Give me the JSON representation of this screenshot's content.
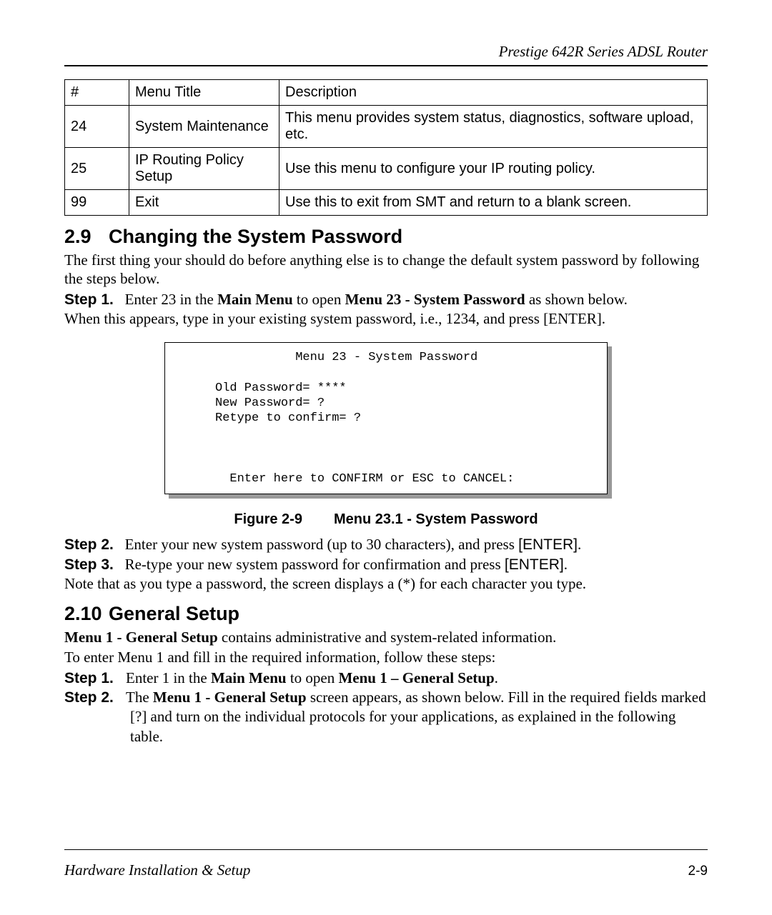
{
  "header": {
    "title": "Prestige 642R Series ADSL Router"
  },
  "table": {
    "headers": {
      "num": "#",
      "title": "Menu Title",
      "desc": "Description"
    },
    "rows": [
      {
        "num": "24",
        "title": "System Maintenance",
        "desc": "This menu provides system status, diagnostics, software upload, etc."
      },
      {
        "num": "25",
        "title": "IP Routing Policy Setup",
        "desc": "Use this menu to configure your IP routing policy."
      },
      {
        "num": "99",
        "title": "Exit",
        "desc": "Use this to exit from SMT and return to a blank screen."
      }
    ]
  },
  "section29": {
    "num": "2.9",
    "title": "Changing the System Password",
    "intro": "The first thing your should do before anything else is to change the default system password by following the steps below.",
    "step1": {
      "label": "Step 1.",
      "pre": "Enter 23 in the ",
      "bold1": "Main Menu",
      "mid": " to open ",
      "bold2": "Menu 23 - System Password",
      "post": " as shown below."
    },
    "after_step1": "When this appears, type in your existing system password, i.e., 1234, and press [ENTER].",
    "figure": {
      "title_line": "           Menu 23 - System Password",
      "body": "Old Password= ****\nNew Password= ?\nRetype to confirm= ?",
      "footer_line": "  Enter here to CONFIRM or ESC to CANCEL:"
    },
    "figure_caption": {
      "label": "Figure 2-9",
      "title": "Menu 23.1 - System Password"
    },
    "step2": {
      "label": "Step 2.",
      "text": "Enter your new system password (up to 30 characters), and press ",
      "enter": "[ENTER]",
      "tail": "."
    },
    "step3": {
      "label": "Step 3.",
      "text": "Re-type your new system password for confirmation and press ",
      "enter": "[ENTER]",
      "tail": "."
    },
    "note": "Note that as you type a password, the screen displays a (*) for each character you type."
  },
  "section210": {
    "num": "2.10",
    "title": "General Setup",
    "line1": {
      "bold": "Menu 1 - General Setup",
      "rest": " contains administrative and system-related information."
    },
    "line2": "To enter Menu 1 and fill in the required information, follow these steps:",
    "step1": {
      "label": "Step 1.",
      "pre": "Enter 1 in the ",
      "bold1": "Main Menu",
      "mid": " to open ",
      "bold2": "Menu 1 – General Setup",
      "post": "."
    },
    "step2": {
      "label": "Step 2.",
      "pre": "The ",
      "bold1": "Menu 1 - General Setup",
      "mid": " screen appears, as shown below. Fill in the required fields marked [?] and turn on the individual protocols for your applications, as explained in the following table."
    }
  },
  "footer": {
    "left": "Hardware Installation & Setup",
    "right": "2-9"
  }
}
